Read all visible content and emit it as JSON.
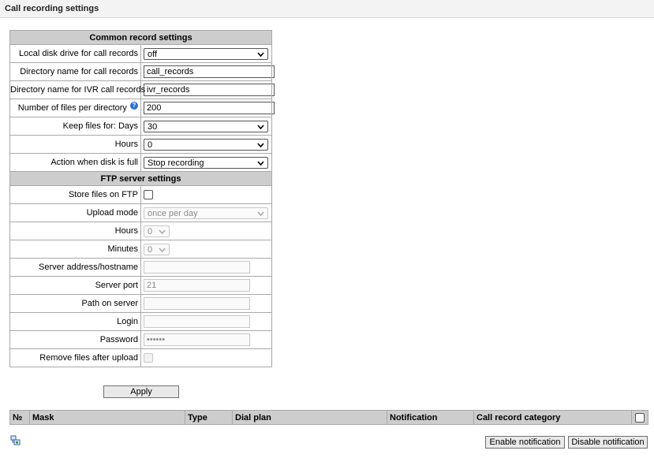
{
  "page": {
    "title": "Call recording settings"
  },
  "common": {
    "header": "Common record settings",
    "local_disk": {
      "label": "Local disk drive for call records",
      "value": "off"
    },
    "dir_name": {
      "label": "Directory name for call records",
      "value": "call_records"
    },
    "ivr_dir_name": {
      "label": "Directory name for IVR call records",
      "value": "ivr_records"
    },
    "files_per_dir": {
      "label": "Number of files per directory",
      "value": "200",
      "help_glyph": "?"
    },
    "keep_days": {
      "label": "Keep files for: Days",
      "value": "30"
    },
    "keep_hours": {
      "label": "Hours",
      "value": "0"
    },
    "disk_full_action": {
      "label": "Action when disk is full",
      "value": "Stop recording"
    }
  },
  "ftp": {
    "header": "FTP server settings",
    "store_on_ftp": {
      "label": "Store files on FTP",
      "checked": false
    },
    "upload_mode": {
      "label": "Upload mode",
      "value": "once per day"
    },
    "hours": {
      "label": "Hours",
      "value": "0"
    },
    "minutes": {
      "label": "Minutes",
      "value": "0"
    },
    "server_address": {
      "label": "Server address/hostname",
      "value": ""
    },
    "server_port": {
      "label": "Server port",
      "value": "21"
    },
    "path_on_server": {
      "label": "Path on server",
      "value": ""
    },
    "login": {
      "label": "Login",
      "value": ""
    },
    "password": {
      "label": "Password",
      "value": "••••••"
    },
    "remove_after_upload": {
      "label": "Remove files after upload",
      "checked": false
    }
  },
  "apply_label": "Apply",
  "table": {
    "columns": [
      "№",
      "Mask",
      "Type",
      "Dial plan",
      "Notification",
      "Call record category"
    ]
  },
  "buttons": {
    "enable_notification": "Enable notification",
    "disable_notification": "Disable notification"
  },
  "icons": {
    "add": "add-row-icon",
    "dropdown": "chevron-down-icon",
    "help": "help-icon"
  },
  "colors": {
    "header_bg": "#cdcdcd",
    "border": "#a9a9a9",
    "help_icon": "#2d6fd2"
  }
}
